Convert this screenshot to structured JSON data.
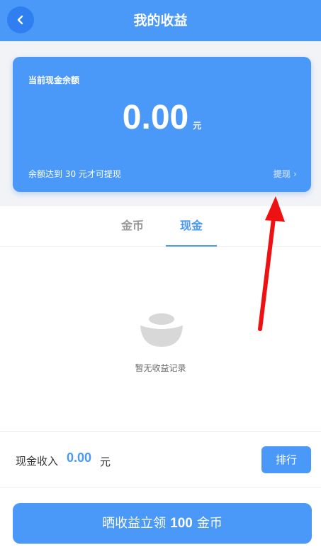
{
  "header": {
    "title": "我的收益",
    "back_icon": "chevron-left-icon"
  },
  "balance_card": {
    "label": "当前现金余额",
    "amount": "0.00",
    "unit": "元",
    "threshold_note": "余额达到 30 元才可提现",
    "withdraw_label": "提现 ›"
  },
  "tabs": [
    {
      "label": "金币",
      "active": false
    },
    {
      "label": "现金",
      "active": true
    }
  ],
  "empty_state": {
    "icon": "ingot-icon",
    "text": "暂无收益记录"
  },
  "income": {
    "label": "现金收入",
    "value": "0.00",
    "unit": "元",
    "rank_label": "排行"
  },
  "share_button": {
    "prefix": "晒收益立领",
    "amount": "100",
    "suffix": "金币"
  },
  "colors": {
    "primary": "#4a98f7",
    "annotation_arrow": "#ee1111"
  }
}
